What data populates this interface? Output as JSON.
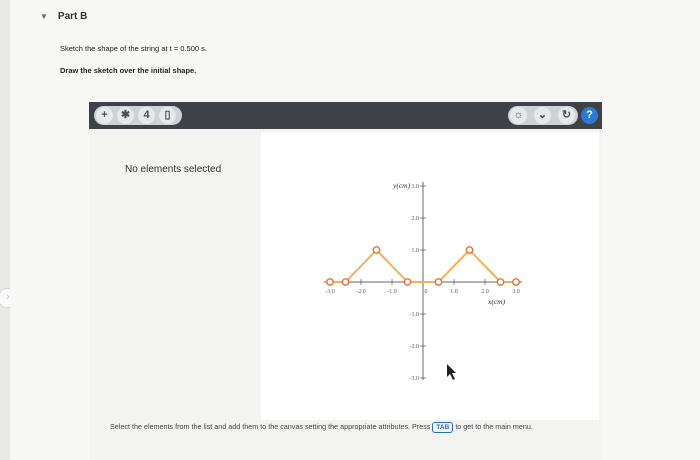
{
  "part": {
    "title": "Part B"
  },
  "instructions": {
    "line1": "Sketch the shape of the string at t = 0.500 s.",
    "line2": "Draw the sketch over the initial shape."
  },
  "toolbar": {
    "left_icons": [
      "plus-icon",
      "asterisk-icon",
      "number-4-icon",
      "trash-icon"
    ],
    "right_icons": [
      "bulb-icon",
      "chevron-down-icon",
      "reset-icon"
    ],
    "help_label": "?",
    "plus_label": "+",
    "asterisk_label": "✱",
    "four_label": "4",
    "trash_label": "▯",
    "bulb_label": "☼",
    "chevron_label": "⌄",
    "reset_label": "↻"
  },
  "side_panel": {
    "status": "No elements selected"
  },
  "graph": {
    "y_axis_label": "y(cm)",
    "x_axis_label": "x(cm)",
    "x_ticks": [
      "-3.0",
      "-2.0",
      "-1.0",
      "0",
      "1.0",
      "2.0",
      "3.0"
    ],
    "y_ticks": [
      "3.0",
      "2.0",
      "1.0",
      "-1.0",
      "-2.0",
      "-3.0"
    ]
  },
  "chart_data": {
    "type": "line",
    "xlabel": "x(cm)",
    "ylabel": "y(cm)",
    "xlim": [
      -3.0,
      3.0
    ],
    "ylim": [
      -3.0,
      3.0
    ],
    "series": [
      {
        "x": [
          -3.0,
          -2.5,
          -1.5,
          -0.5,
          0.5,
          1.5,
          2.5,
          3.0
        ],
        "y": [
          0,
          0,
          1,
          0,
          0,
          1,
          0,
          0
        ]
      }
    ]
  },
  "footer": {
    "text_before": "Select the elements from the list and add them to the canvas setting the appropriate attributes. Press",
    "tab_key": "TAB",
    "text_after": "to get to the main menu."
  }
}
